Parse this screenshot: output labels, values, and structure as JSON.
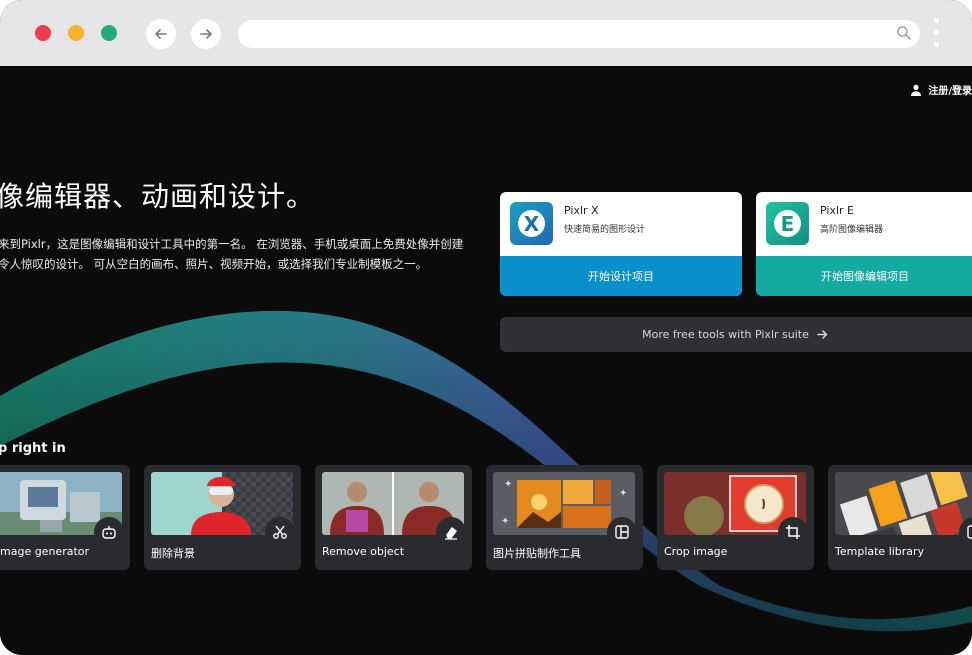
{
  "browser": {
    "address_value": "",
    "icons": [
      "back-arrow-icon",
      "forward-arrow-icon",
      "search-icon",
      "kebab-menu-icon"
    ]
  },
  "header": {
    "login_label": "注册/登录"
  },
  "hero": {
    "headline": "像编辑器、动画和设计。",
    "description": "来到Pixlr，这是图像编辑和设计工具中的第一名。 在浏览器、手机或桌面上免费处像并创建令人惊叹的设计。 可从空白的画布、照片、视频开始，或选择我们专业制模板之一。"
  },
  "apps": [
    {
      "logo_letter": "X",
      "name": "Pixlr X",
      "subtitle": "快速简易的图形设计",
      "cta": "开始设计项目",
      "color": "#0a8fcd"
    },
    {
      "logo_letter": "E",
      "name": "Pixlr E",
      "subtitle": "高阶图像编辑器",
      "cta": "开始图像编辑项目",
      "color": "#13aaa2"
    }
  ],
  "more_tools": {
    "label": "More free tools with Pixlr suite",
    "icon": "arrow-right-icon"
  },
  "section": {
    "jump_title": "p right in"
  },
  "tools": [
    {
      "label": "mage generator",
      "icon": "robot-icon"
    },
    {
      "label": "删除背景",
      "icon": "scissors-icon"
    },
    {
      "label": "Remove object",
      "icon": "eraser-icon"
    },
    {
      "label": "图片拼贴制作工具",
      "icon": "collage-icon"
    },
    {
      "label": "Crop image",
      "icon": "crop-icon"
    },
    {
      "label": "Template library",
      "icon": "template-icon"
    }
  ],
  "colors": {
    "background": "#0b0b0c",
    "chrome": "#e6e6e8",
    "card": "#2a2b2f",
    "accent_blue": "#0a8fcd",
    "accent_teal": "#13aaa2"
  }
}
